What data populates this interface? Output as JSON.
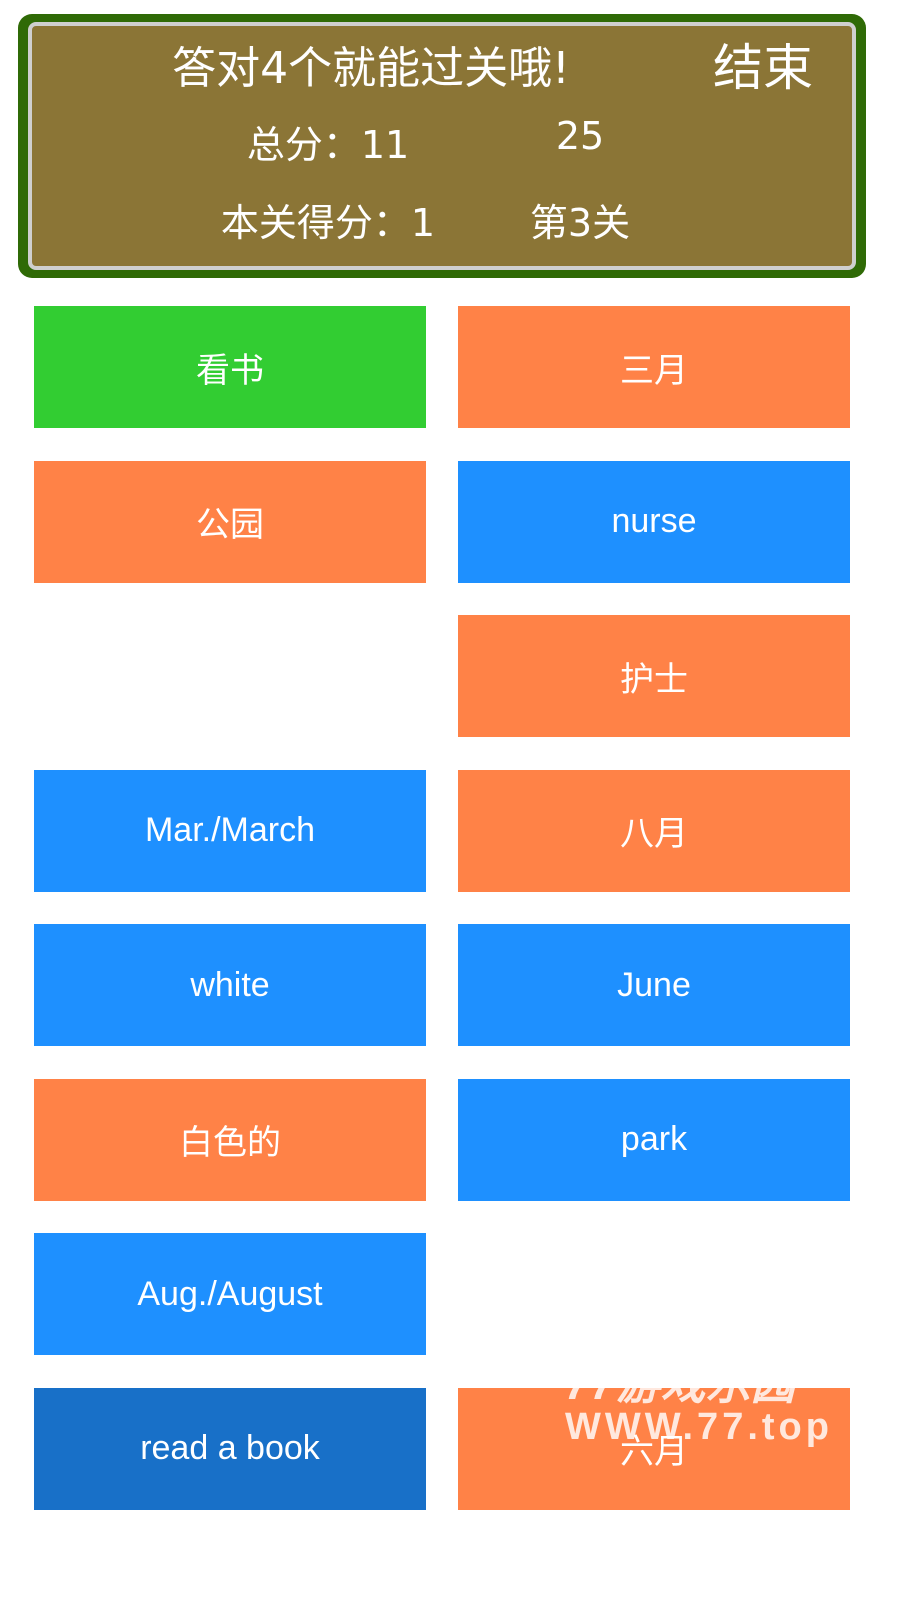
{
  "header": {
    "hint": "答对4个就能过关哦!",
    "end_button": "结束",
    "total_score": "总分：11",
    "timer": "25",
    "level_score": "本关得分：1",
    "level": "第3关"
  },
  "colors": {
    "green": "#32CD32",
    "orange": "#FF8247",
    "blue": "#1E90FF",
    "selected_blue": "#1870C8",
    "panel": "#8B7536",
    "panel_border": "#2F6A06"
  },
  "cards": [
    {
      "label": "看书",
      "color": "#32CD32"
    },
    {
      "label": "三月",
      "color": "#FF8247"
    },
    {
      "label": "公园",
      "color": "#FF8247"
    },
    {
      "label": "nurse",
      "color": "#1E90FF"
    },
    {
      "label": "",
      "color": "",
      "empty": true
    },
    {
      "label": "护士",
      "color": "#FF8247"
    },
    {
      "label": "Mar./March",
      "color": "#1E90FF"
    },
    {
      "label": "八月",
      "color": "#FF8247"
    },
    {
      "label": "white",
      "color": "#1E90FF"
    },
    {
      "label": "June",
      "color": "#1E90FF"
    },
    {
      "label": "白色的",
      "color": "#FF8247"
    },
    {
      "label": "park",
      "color": "#1E90FF"
    },
    {
      "label": "Aug./August",
      "color": "#1E90FF"
    },
    {
      "label": "",
      "color": "",
      "empty": true
    },
    {
      "label": "read a book",
      "color": "#1870C8"
    },
    {
      "label": "六月",
      "color": "#FF8247"
    }
  ],
  "watermark": {
    "line1": "77游戏乐园",
    "line2": "WWW.77.top"
  }
}
